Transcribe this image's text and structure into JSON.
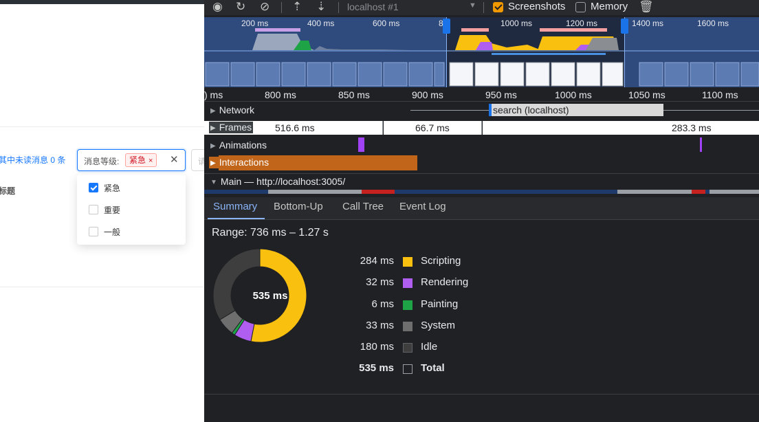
{
  "app": {
    "unread_text": "其中未读消息 0 条",
    "filter": {
      "label": "消息等级:",
      "selected_tag": "紧急",
      "tag_close": "×",
      "clear_icon": "✕"
    },
    "next_field_placeholder": "请",
    "column_header": "标题",
    "options": [
      {
        "label": "紧急",
        "checked": true
      },
      {
        "label": "重要",
        "checked": false
      },
      {
        "label": "一般",
        "checked": false
      }
    ]
  },
  "devtools": {
    "toolbar": {
      "profile_select": "localhost #1",
      "screenshots_label": "Screenshots",
      "screenshots_checked": true,
      "memory_label": "Memory",
      "memory_checked": false,
      "icons": [
        "record-icon",
        "reload-icon",
        "clear-icon",
        "upload-icon",
        "download-icon",
        "trash-icon"
      ]
    },
    "overview_ticks": [
      "200 ms",
      "400 ms",
      "600 ms",
      "8",
      "1000 ms",
      "1200 ms",
      "1400 ms",
      "1600 ms"
    ],
    "ruler_ticks": [
      ") ms",
      "800 ms",
      "850 ms",
      "900 ms",
      "950 ms",
      "1000 ms",
      "1050 ms",
      "1100 ms"
    ],
    "tracks": {
      "network": {
        "label": "Network",
        "request": "search (localhost)"
      },
      "frames": {
        "label": "Frames",
        "segments": [
          "516.6 ms",
          "66.7 ms",
          "283.3 ms"
        ]
      },
      "animations": {
        "label": "Animations"
      },
      "interactions": {
        "label": "Interactions"
      },
      "main": {
        "label": "Main — http://localhost:3005/"
      }
    },
    "tabs": [
      "Summary",
      "Bottom-Up",
      "Call Tree",
      "Event Log"
    ],
    "active_tab": "Summary",
    "summary": {
      "range": "Range: 736 ms – 1.27 s",
      "total_center": "535 ms",
      "rows": [
        {
          "value": "284 ms",
          "name": "Scripting",
          "color": "#f9c00f"
        },
        {
          "value": "32 ms",
          "name": "Rendering",
          "color": "#b05ef0"
        },
        {
          "value": "6 ms",
          "name": "Painting",
          "color": "#1ea446"
        },
        {
          "value": "33 ms",
          "name": "System",
          "color": "#6e6e6e"
        },
        {
          "value": "180 ms",
          "name": "Idle",
          "color": "#3e3e3e"
        },
        {
          "value": "535 ms",
          "name": "Total",
          "color": "#202124"
        }
      ]
    },
    "chart_data": {
      "type": "pie",
      "categories": [
        "Scripting",
        "Rendering",
        "Painting",
        "System",
        "Idle"
      ],
      "values": [
        284,
        32,
        6,
        33,
        180
      ],
      "total": 535,
      "unit": "ms"
    }
  }
}
